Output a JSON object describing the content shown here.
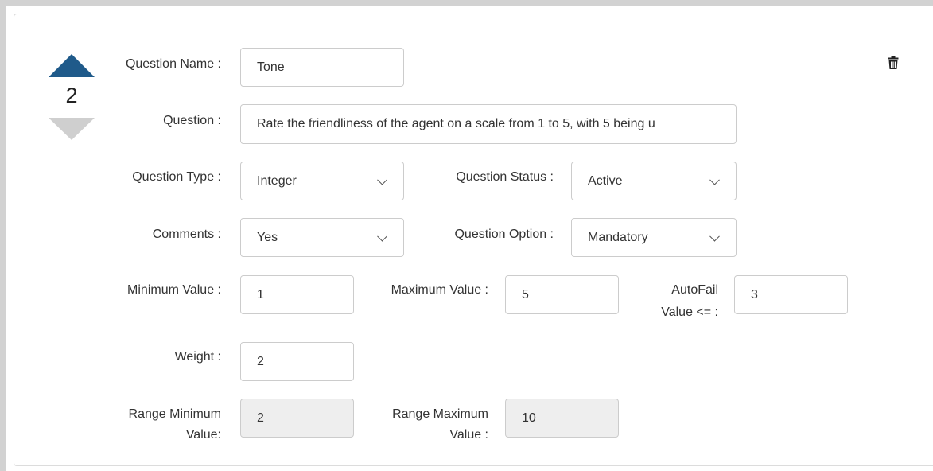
{
  "order": {
    "number": "2"
  },
  "icons": {
    "move_up": "triangle-up",
    "move_down": "triangle-down",
    "delete": "trash"
  },
  "fields": {
    "question_name": {
      "label": "Question Name :",
      "value": "Tone"
    },
    "question": {
      "label": "Question :",
      "value": "Rate the friendliness of the agent on a scale from 1 to 5, with 5 being u"
    },
    "question_type": {
      "label": "Question Type :",
      "value": "Integer"
    },
    "question_status": {
      "label": "Question Status :",
      "value": "Active"
    },
    "comments": {
      "label": "Comments :",
      "value": "Yes"
    },
    "question_option": {
      "label": "Question Option :",
      "value": "Mandatory"
    },
    "minimum_value": {
      "label": "Minimum Value :",
      "value": "1"
    },
    "maximum_value": {
      "label": "Maximum Value :",
      "value": "5"
    },
    "autofail": {
      "label_line1": "AutoFail",
      "label_line2": "Value <= :",
      "value": "3"
    },
    "weight": {
      "label": "Weight :",
      "value": "2"
    },
    "range_minimum": {
      "label_line1": "Range Minimum",
      "label_line2": "Value:",
      "value": "2"
    },
    "range_maximum": {
      "label_line1": "Range Maximum",
      "label_line2": "Value :",
      "value": "10"
    }
  },
  "colors": {
    "accent": "#1f5a8a",
    "inactive_arrow": "#cfcfcf",
    "disabled_bg": "#eeeeee"
  }
}
